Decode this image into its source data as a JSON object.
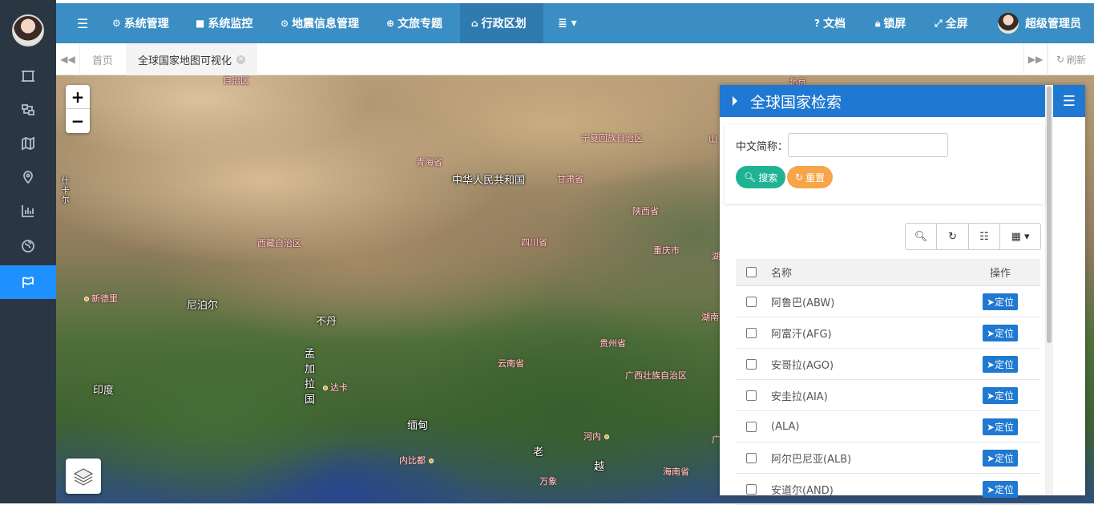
{
  "topbar": {
    "menus": [
      {
        "icon": "hamburger-icon",
        "label": ""
      },
      {
        "icon": "gear-icon",
        "label": "系统管理"
      },
      {
        "icon": "video-icon",
        "label": "系统监控"
      },
      {
        "icon": "location-pin-icon",
        "label": "地震信息管理"
      },
      {
        "icon": "globe-icon",
        "label": "文旅专题"
      },
      {
        "icon": "bank-icon",
        "label": "行政区划"
      },
      {
        "icon": "list-dropdown-icon",
        "label": ""
      }
    ],
    "right": {
      "docs": "文档",
      "lock": "锁屏",
      "fullscreen": "全屏",
      "user": "超级管理员"
    }
  },
  "tabs": {
    "home": "首页",
    "active": "全球国家地图可视化",
    "refresh": "刷新"
  },
  "map": {
    "zoom_in": "+",
    "zoom_out": "−",
    "labels": {
      "china": "中华人民共和国",
      "nepal": "尼泊尔",
      "bhutan": "不丹",
      "india": "印度",
      "bangladesh": "孟加拉国",
      "myanmar": "缅甸",
      "laos": "老",
      "vietnam": "越",
      "qinghai": "青海省",
      "gansu": "甘肃省",
      "ningxia": "宁夏回族自治区",
      "shaanxi": "陕西省",
      "sichuan": "四川省",
      "chongqing": "重庆市",
      "tibet": "西藏自治区",
      "yunnan": "云南省",
      "guizhou": "贵州省",
      "guangxi": "广西壮族自治区",
      "hainan": "海南省",
      "hunan": "湖南",
      "xinjiang": "自治区",
      "beijing": "北京",
      "new_delhi": "新德里",
      "dhaka": "达卡",
      "naypyidaw": "内比都",
      "hanoi": "河内",
      "vientiane": "万象",
      "shan": "山",
      "hu": "湖",
      "xi": "什",
      "ka": "卡",
      "er": "尔",
      "guang": "广"
    }
  },
  "panel": {
    "title": "全球国家检索",
    "search_label": "中文简称：",
    "search_placeholder": "",
    "search_button": "搜索",
    "reset_button": "重置",
    "table": {
      "col_name": "名称",
      "col_op": "操作",
      "locate_label": "定位",
      "rows": [
        "阿鲁巴(ABW)",
        "阿富汗(AFG)",
        "安哥拉(AGO)",
        "安圭拉(AIA)",
        "(ALA)",
        "阿尔巴尼亚(ALB)",
        "安道尔(AND)"
      ]
    }
  },
  "colors": {
    "sidebar_bg": "#2b3643",
    "topbar_bg": "#3a8ec4",
    "accent": "#1f78d1",
    "search_btn": "#1fb394",
    "reset_btn": "#f7a54a"
  }
}
